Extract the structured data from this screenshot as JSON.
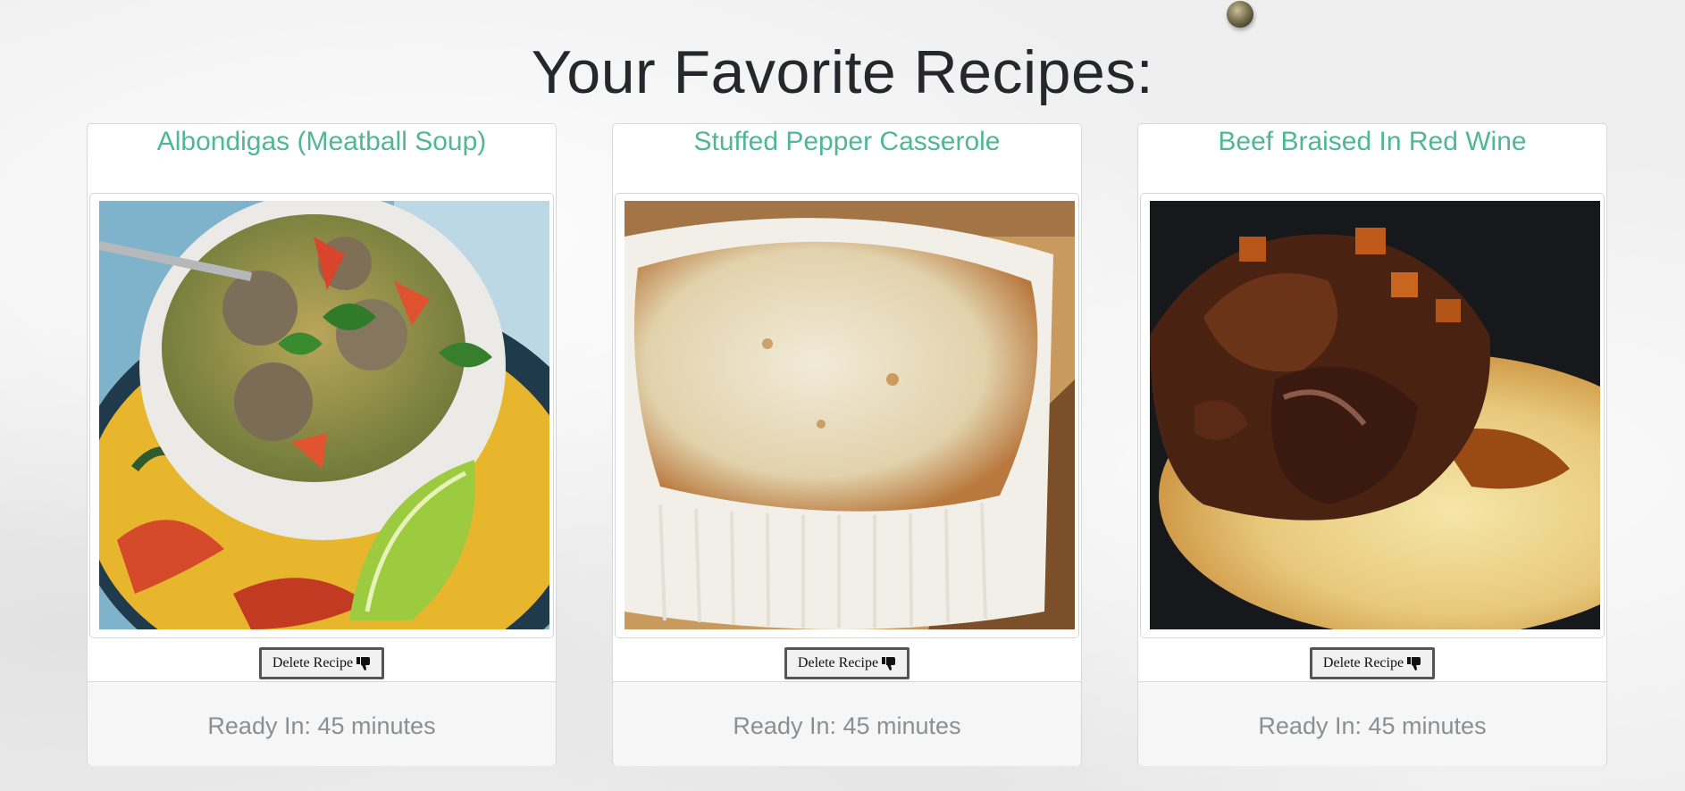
{
  "page": {
    "title": "Your Favorite Recipes:"
  },
  "recipes": [
    {
      "title": "Albondigas (Meatball Soup)",
      "delete_label": "Delete Recipe",
      "ready_in": "Ready In: 45 minutes",
      "image": "meatball-soup-photo"
    },
    {
      "title": "Stuffed Pepper Casserole",
      "delete_label": "Delete Recipe",
      "ready_in": "Ready In: 45 minutes",
      "image": "casserole-photo"
    },
    {
      "title": "Beef Braised In Red Wine",
      "delete_label": "Delete Recipe",
      "ready_in": "Ready In: 45 minutes",
      "image": "braised-beef-photo"
    }
  ],
  "icons": {
    "delete": "thumbs-down-icon"
  },
  "colors": {
    "card_title": "#4fb696",
    "footer_text": "#8b8f91",
    "page_title": "#24272b"
  }
}
